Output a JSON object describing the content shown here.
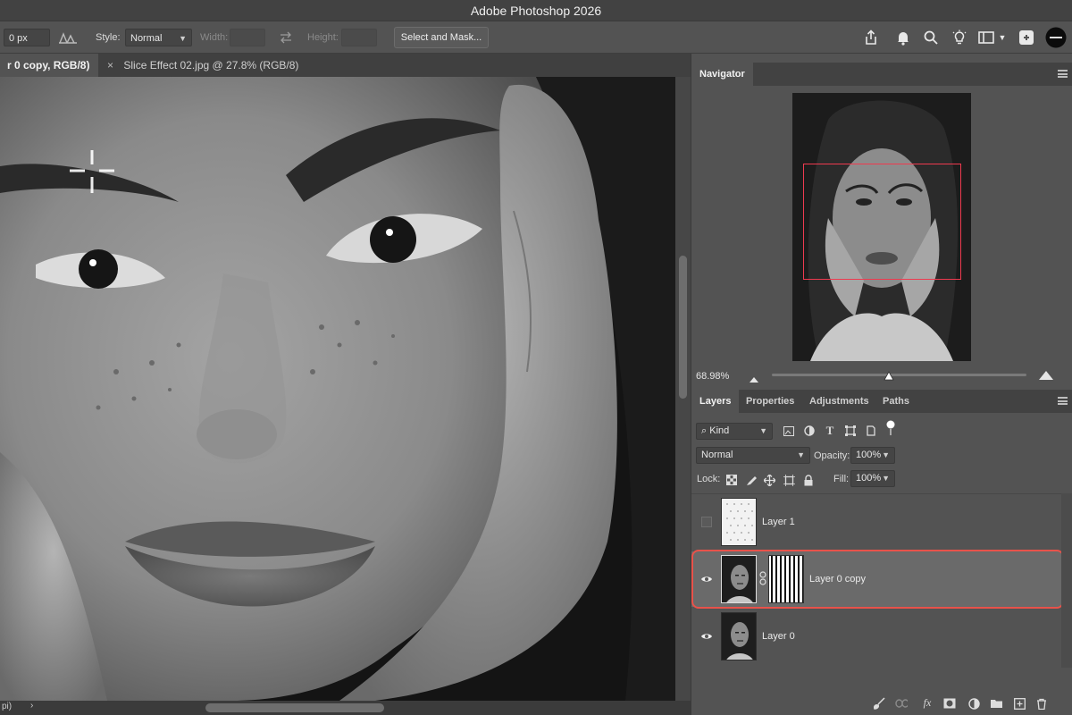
{
  "app": {
    "title": "Adobe Photoshop 2026"
  },
  "options_bar": {
    "feather_value": "0 px",
    "style_label": "Style:",
    "style_value": "Normal",
    "width_label": "Width:",
    "height_label": "Height:",
    "select_mask_label": "Select and Mask..."
  },
  "tabs": [
    {
      "label": "r 0 copy, RGB/8) *",
      "active": true
    },
    {
      "label": "Slice Effect 02.jpg @ 27.8% (RGB/8)",
      "active": false
    }
  ],
  "tab_close_glyph": "×",
  "status": {
    "left_text": "pi)",
    "arrow": "›"
  },
  "navigator": {
    "tab_label": "Navigator",
    "zoom": "68.98%",
    "zoom_slider_fraction": 0.46,
    "view_box_color": "#ee3a4f"
  },
  "layers_panel": {
    "tabs": [
      "Layers",
      "Properties",
      "Adjustments",
      "Paths"
    ],
    "filter_kind": "Kind",
    "blend_mode": "Normal",
    "opacity_label": "Opacity:",
    "opacity_value": "100%",
    "lock_label": "Lock:",
    "fill_label": "Fill:",
    "fill_value": "100%",
    "layers": [
      {
        "name": "Layer 1",
        "visible": false,
        "selected": false
      },
      {
        "name": "Layer 0 copy",
        "visible": true,
        "selected": true
      },
      {
        "name": "Layer 0",
        "visible": true,
        "selected": false
      }
    ],
    "highlight_color": "#e8524a"
  }
}
